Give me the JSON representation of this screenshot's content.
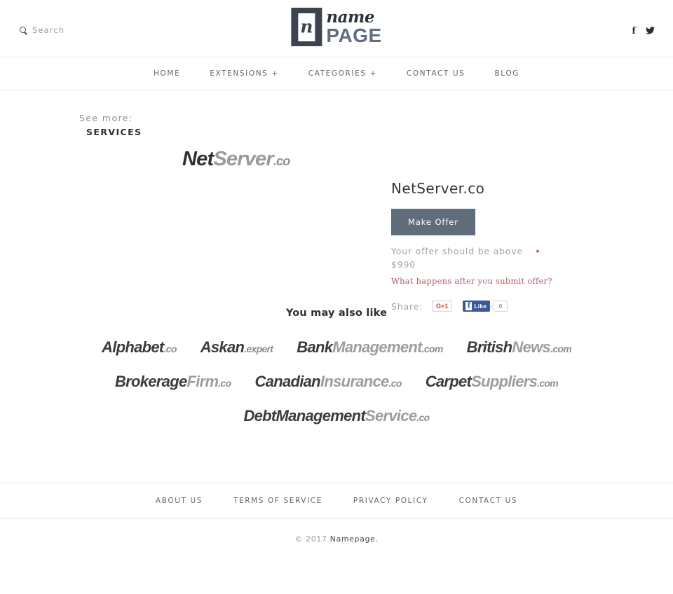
{
  "header": {
    "search": {
      "label": "Search",
      "icon": "search-icon"
    },
    "logo": {
      "mark_letter": "n",
      "word_script": "name",
      "word_bold": "PAGE"
    },
    "social": [
      {
        "name": "facebook-icon",
        "glyph": "f"
      },
      {
        "name": "twitter-icon",
        "glyph": "ᵕ"
      }
    ]
  },
  "nav": {
    "items": [
      {
        "label": "HOME",
        "name": "nav-home"
      },
      {
        "label": "EXTENSIONS +",
        "name": "nav-extensions"
      },
      {
        "label": "CATEGORIES +",
        "name": "nav-categories"
      },
      {
        "label": "CONTACT US",
        "name": "nav-contact-us"
      },
      {
        "label": "BLOG",
        "name": "nav-blog"
      }
    ]
  },
  "see_more": {
    "label": "See more:",
    "category": "SERVICES"
  },
  "domain_logo": {
    "primary": "Net",
    "secondary": "Server",
    "tld": ".co"
  },
  "offer": {
    "title": "NetServer.co",
    "button_label": "Make Offer",
    "above_text": "Your offer should be above",
    "arrow": "▸",
    "price": "$990",
    "faq_link": "What happens after you submit offer?",
    "share_label": "Share:",
    "gplus_label": "G+1",
    "fb_like_label": "Like",
    "fb_like_f": "f",
    "fb_count": "0",
    "button_color": "#5f6d7a",
    "accent_red": "#b2575d"
  },
  "also_like": {
    "title": "You may also like",
    "rows": [
      [
        {
          "primary": "Alphabet",
          "secondary": "",
          "tld": ".co"
        },
        {
          "primary": "Askan",
          "secondary": "",
          "tld": ".expert"
        },
        {
          "primary": "Bank",
          "secondary": "Management",
          "tld": ".com"
        },
        {
          "primary": "British",
          "secondary": "News",
          "tld": ".com"
        }
      ],
      [
        {
          "primary": "Brokerage",
          "secondary": "Firm",
          "tld": ".co"
        },
        {
          "primary": "Canadian",
          "secondary": "Insurance",
          "tld": ".co"
        },
        {
          "primary": "Carpet",
          "secondary": "Suppliers",
          "tld": ".com"
        }
      ],
      [
        {
          "primary": "DebtManagement",
          "secondary": "Service",
          "tld": ".co"
        }
      ]
    ]
  },
  "footer": {
    "links": [
      {
        "label": "ABOUT US",
        "name": "footer-about-us"
      },
      {
        "label": "TERMS OF SERVICE",
        "name": "footer-terms-of-service"
      },
      {
        "label": "PRIVACY POLICY",
        "name": "footer-privacy-policy"
      },
      {
        "label": "CONTACT US",
        "name": "footer-contact-us"
      }
    ],
    "copyright_prefix": "© 2017 ",
    "copyright_brand": "Namepage."
  }
}
